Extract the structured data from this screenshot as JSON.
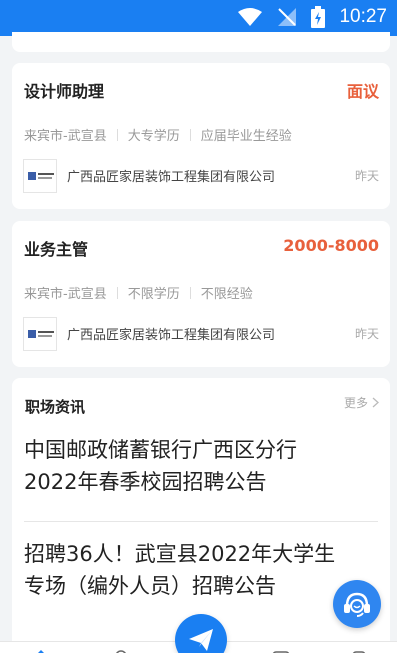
{
  "status_bar": {
    "time": "10:27"
  },
  "jobs": [
    {
      "title": "设计师助理",
      "salary": "面议",
      "location": "来宾市-武宣县",
      "education": "大专学历",
      "experience": "应届毕业生经验",
      "company": "广西品匠家居装饰工程集团有限公司",
      "posted": "昨天"
    },
    {
      "title": "业务主管",
      "salary": "2000-8000",
      "location": "来宾市-武宣县",
      "education": "不限学历",
      "experience": "不限经验",
      "company": "广西品匠家居装饰工程集团有限公司",
      "posted": "昨天"
    }
  ],
  "news": {
    "header": "职场资讯",
    "more": "更多",
    "items": [
      {
        "line1": "中国邮政储蓄银行广西区分行",
        "line2": "2022年春季校园招聘公告"
      },
      {
        "line1": "招聘36人！武宣县2022年大学生",
        "line2": "专场（编外人员）招聘公告"
      }
    ]
  },
  "colors": {
    "brand": "#1a7ff2",
    "salary": "#e8603c"
  },
  "icons": [
    "wifi-icon",
    "signal-icon",
    "battery-icon",
    "chevron-right-icon",
    "customer-service-icon",
    "paper-plane-icon"
  ]
}
